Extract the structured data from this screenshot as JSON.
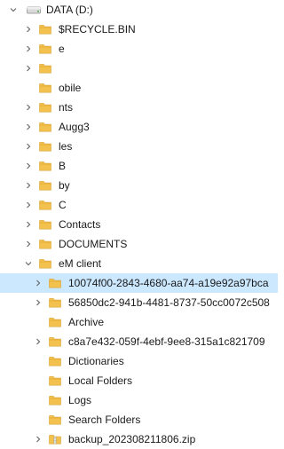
{
  "tree": {
    "drive": {
      "label": "DATA (D:)",
      "icon": "drive-icon",
      "expanded": true
    },
    "items": [
      {
        "label": "$RECYCLE.BIN",
        "icon": "folder-icon",
        "expandable": true,
        "expanded": false,
        "selected": false,
        "depth": 1
      },
      {
        "label": "e",
        "icon": "folder-icon",
        "expandable": true,
        "expanded": false,
        "selected": false,
        "depth": 1
      },
      {
        "label": "",
        "icon": "folder-icon",
        "expandable": true,
        "expanded": false,
        "selected": false,
        "depth": 1
      },
      {
        "label": "obile",
        "icon": "folder-icon",
        "expandable": false,
        "expanded": false,
        "selected": false,
        "depth": 1
      },
      {
        "label": "nts",
        "icon": "folder-icon",
        "expandable": true,
        "expanded": false,
        "selected": false,
        "depth": 1
      },
      {
        "label": "Augg3",
        "icon": "folder-icon",
        "expandable": true,
        "expanded": false,
        "selected": false,
        "depth": 1
      },
      {
        "label": "les",
        "icon": "folder-icon",
        "expandable": true,
        "expanded": false,
        "selected": false,
        "depth": 1
      },
      {
        "label": "B",
        "icon": "folder-icon",
        "expandable": true,
        "expanded": false,
        "selected": false,
        "depth": 1
      },
      {
        "label": "by",
        "icon": "folder-icon",
        "expandable": true,
        "expanded": false,
        "selected": false,
        "depth": 1
      },
      {
        "label": "C",
        "icon": "folder-icon",
        "expandable": true,
        "expanded": false,
        "selected": false,
        "depth": 1
      },
      {
        "label": "Contacts",
        "icon": "folder-icon",
        "expandable": true,
        "expanded": false,
        "selected": false,
        "depth": 1
      },
      {
        "label": "DOCUMENTS",
        "icon": "folder-icon",
        "expandable": true,
        "expanded": false,
        "selected": false,
        "depth": 1
      },
      {
        "label": "eM client",
        "icon": "folder-icon",
        "expandable": true,
        "expanded": true,
        "selected": false,
        "depth": 1
      },
      {
        "label": "10074f00-2843-4680-aa74-a19e92a97bca",
        "icon": "folder-icon",
        "expandable": true,
        "expanded": false,
        "selected": true,
        "depth": 2
      },
      {
        "label": "56850dc2-941b-4481-8737-50cc0072c508",
        "icon": "folder-icon",
        "expandable": true,
        "expanded": false,
        "selected": false,
        "depth": 2
      },
      {
        "label": "Archive",
        "icon": "folder-icon",
        "expandable": false,
        "expanded": false,
        "selected": false,
        "depth": 2
      },
      {
        "label": "c8a7e432-059f-4ebf-9ee8-315a1c821709",
        "icon": "folder-icon",
        "expandable": true,
        "expanded": false,
        "selected": false,
        "depth": 2
      },
      {
        "label": "Dictionaries",
        "icon": "folder-icon",
        "expandable": false,
        "expanded": false,
        "selected": false,
        "depth": 2
      },
      {
        "label": "Local Folders",
        "icon": "folder-icon",
        "expandable": false,
        "expanded": false,
        "selected": false,
        "depth": 2
      },
      {
        "label": "Logs",
        "icon": "folder-icon",
        "expandable": false,
        "expanded": false,
        "selected": false,
        "depth": 2
      },
      {
        "label": "Search Folders",
        "icon": "folder-icon",
        "expandable": false,
        "expanded": false,
        "selected": false,
        "depth": 2
      },
      {
        "label": "backup_202308211806.zip",
        "icon": "zip-folder-icon",
        "expandable": true,
        "expanded": false,
        "selected": false,
        "depth": 2
      }
    ]
  },
  "colors": {
    "folder": "#f2c14e",
    "folder_dark": "#e0a82e",
    "selection": "#cce8ff",
    "chevron": "#6b6b6b"
  }
}
